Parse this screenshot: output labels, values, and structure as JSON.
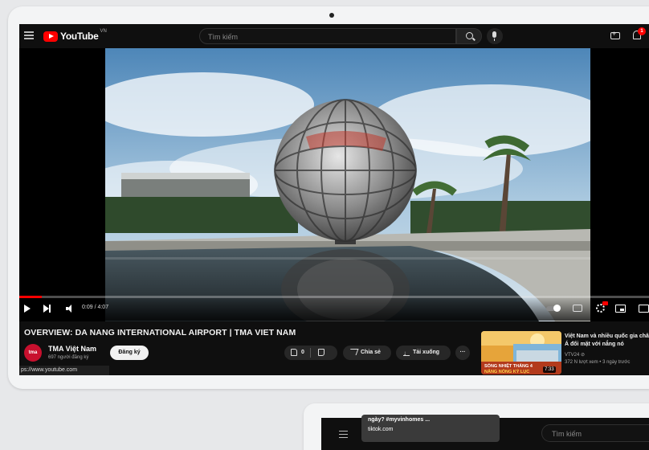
{
  "browser": {
    "status_url": "ps://www.youtube.com"
  },
  "header": {
    "logo_text": "YouTube",
    "region": "VN",
    "search_placeholder": "Tìm kiếm",
    "notifications_badge": "1"
  },
  "player": {
    "time": "0:09 / 4:07",
    "progress_fraction": 0.036
  },
  "video": {
    "title": "OVERVIEW: DA NANG INTERNATIONAL AIRPORT | TMA VIET NAM",
    "channel_name": "TMA Việt Nam",
    "channel_avatar_text": "tma",
    "subscribers": "697 người đăng ký",
    "subscribe_label": "Đăng ký",
    "like_count": "0",
    "share_label": "Chia sẻ",
    "download_label": "Tải xuống",
    "more_label": "···"
  },
  "related": {
    "title": "Việt Nam và nhiều quốc gia châu Á đối mặt với nắng nó",
    "channel": "VTV24 ⊘",
    "meta": "372 N lượt xem • 3 ngày trước",
    "duration": "7:33",
    "thumb_text_1": "SÓNG NHIỆT THÁNG 4",
    "thumb_text_2": "NẮNG NÓNG KỶ LỤC"
  },
  "second_screen": {
    "tooltip_line1": "ngày? #myvinhomes ...",
    "tooltip_line2": "tiktok.com",
    "search_placeholder": "Tìm kiếm"
  },
  "colors": {
    "brand_red": "#ff0000",
    "dark_bg": "#0f0f0f",
    "pill_bg": "#272727"
  }
}
